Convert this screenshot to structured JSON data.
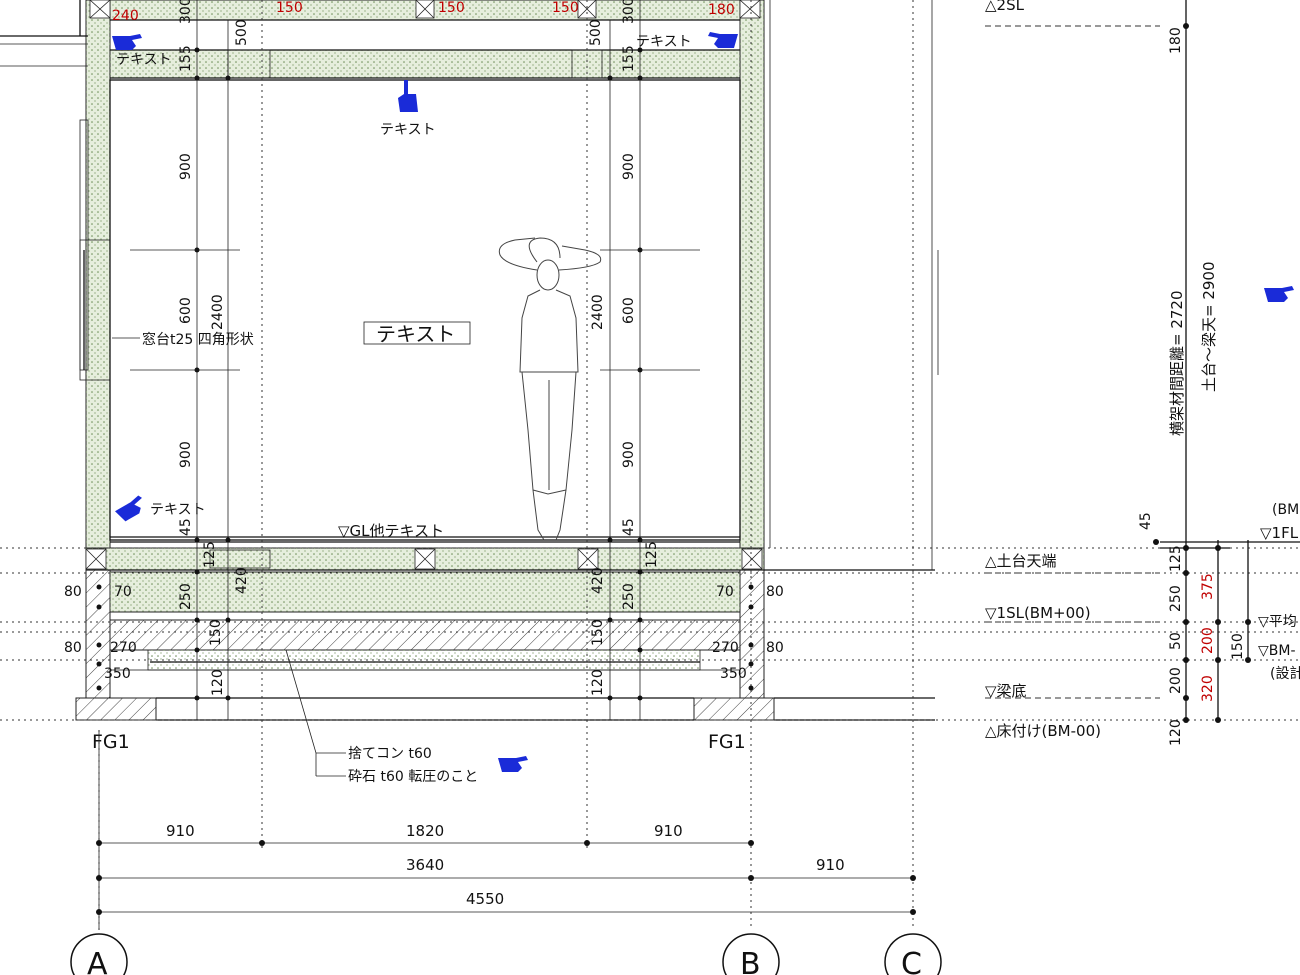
{
  "colors": {
    "line": "#111111",
    "red_dim": "#c00000",
    "wall_fill": "#e6eedd",
    "hand": "#1a2bd8"
  },
  "top_dims": {
    "d240": "240",
    "d150a": "150",
    "d150b": "150",
    "d150c": "150",
    "d180": "180"
  },
  "vertical_dims_left": {
    "d300": "300",
    "d155": "155",
    "d500": "500",
    "d900a": "900",
    "d600": "600",
    "d2400": "2400",
    "d900b": "900",
    "d45": "45",
    "d125": "125",
    "d420": "420",
    "d250": "250",
    "d150": "150",
    "d120": "120"
  },
  "vertical_dims_right": {
    "d300": "300",
    "d155": "155",
    "d500": "500",
    "d900a": "900",
    "d600": "600",
    "d2400": "2400",
    "d900b": "900",
    "d45": "45",
    "d125": "125",
    "d420": "420",
    "d250": "250",
    "d150": "150",
    "d120": "120"
  },
  "side_dims": {
    "l80a": "80",
    "l70": "70",
    "l80b": "80",
    "l270": "270",
    "l350": "350",
    "r70": "70",
    "r80a": "80",
    "r270": "270",
    "r80b": "80",
    "r350": "350"
  },
  "labels": {
    "text_top_left": "テキスト",
    "text_top_right": "テキスト",
    "text_ceiling": "テキスト",
    "text_center": "テキスト",
    "text_lower_left": "テキスト",
    "window_sill": "窓台t25 四角形状",
    "gl_floor": "▽GL他テキスト",
    "fg1_left": "FG1",
    "fg1_right": "FG1",
    "concrete": "捨てコン t60",
    "gravel": "砕石 t60 転圧のこと"
  },
  "bottom_dims": {
    "d910a": "910",
    "d1820": "1820",
    "d910b": "910",
    "d3640": "3640",
    "d910c": "910",
    "d4550": "4550"
  },
  "grid_axes": {
    "a": "A",
    "b": "B",
    "c": "C"
  },
  "levels": {
    "l2sl": "△2SL",
    "sill_top": "△土台天端",
    "l1sl": "▽1SL(BM+00)",
    "beam_bottom": "▽梁底",
    "floor": "△床付け(BM-00)",
    "bm_plus": "(BM+",
    "l1fl": "▽1FL",
    "flat": "▽平均",
    "bm_minus": "▽BM-",
    "design": "(設計"
  },
  "right_dims": {
    "d180": "180",
    "d45": "45",
    "d125": "125",
    "d250": "250",
    "d50": "50",
    "d200": "200",
    "d120": "120",
    "r375": "375",
    "r200": "200",
    "r320": "320",
    "d150": "150"
  },
  "vertical_texts": {
    "frame": "横架材間距離= 2720",
    "sill_beam": "土台～梁天= 2900"
  }
}
